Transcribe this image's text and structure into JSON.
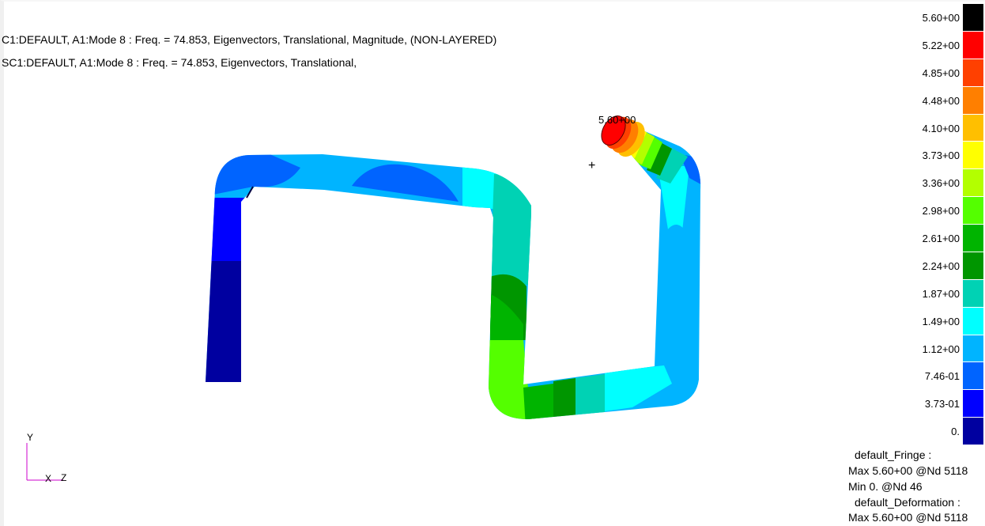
{
  "viewport": {
    "title_line1": "C1:DEFAULT, A1:Mode 8 : Freq. = 74.853, Eigenvectors, Translational, Magnitude, (NON-LAYERED)",
    "title_line2": "SC1:DEFAULT, A1:Mode 8 : Freq. = 74.853, Eigenvectors, Translational,",
    "peak_marker_label": "5.60+00",
    "cursor_glyph": "+"
  },
  "legend": {
    "labels": [
      "5.60+00",
      "5.22+00",
      "4.85+00",
      "4.48+00",
      "4.10+00",
      "3.73+00",
      "3.36+00",
      "2.98+00",
      "2.61+00",
      "2.24+00",
      "1.87+00",
      "1.49+00",
      "1.12+00",
      "7.46-01",
      "3.73-01",
      "0."
    ],
    "colors": [
      "#000000",
      "#ff0000",
      "#ff4000",
      "#ff7f00",
      "#ffbf00",
      "#ffff00",
      "#b3ff00",
      "#54ff00",
      "#00b400",
      "#009600",
      "#00d2b4",
      "#00ffff",
      "#00b4ff",
      "#0064ff",
      "#0000ff",
      "#0000a0"
    ]
  },
  "summary": {
    "fringe_title": "default_Fringe :",
    "fringe_max": "Max 5.60+00 @Nd 5118",
    "fringe_min": "Min  0. @Nd 46",
    "deformation_title": "default_Deformation :",
    "deformation_max": "Max 5.60+00 @Nd 5118"
  },
  "triad": {
    "y_label": "Y",
    "x_label": "X",
    "z_label": "Z",
    "axis_color": "#cc00cc"
  }
}
